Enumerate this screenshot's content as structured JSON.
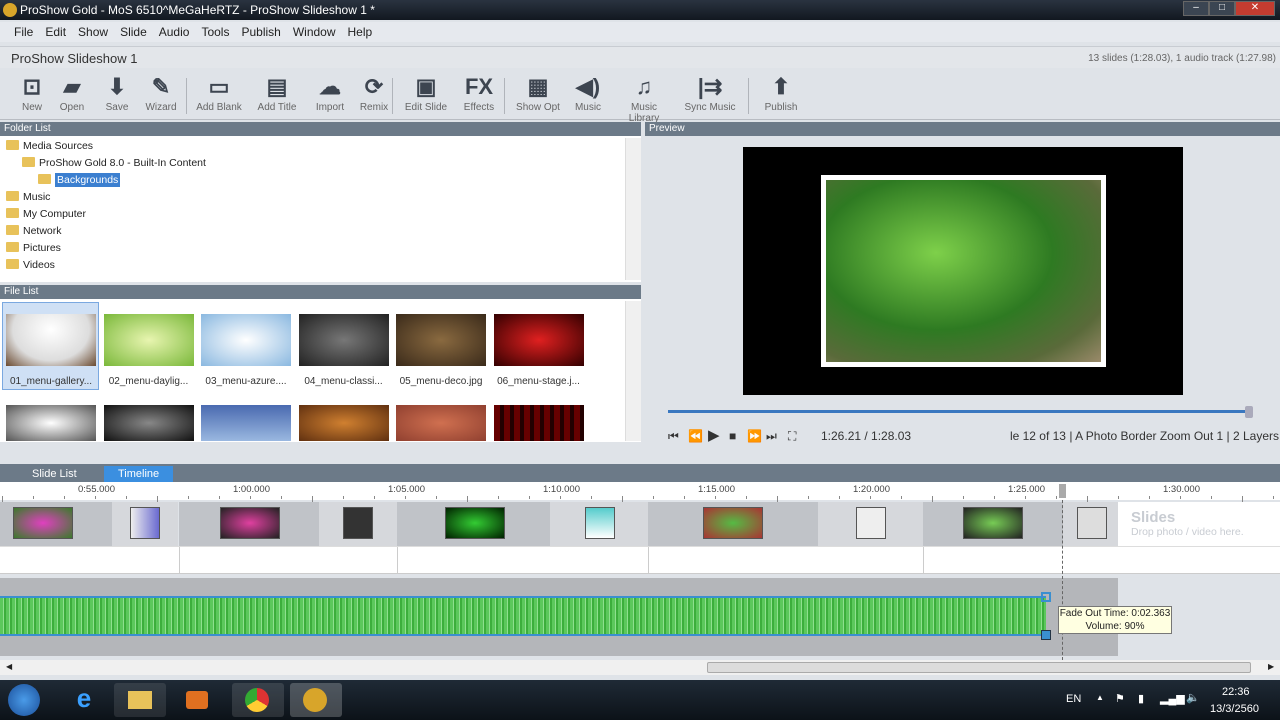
{
  "window": {
    "title": "ProShow Gold - MoS 6510^MeGaHeRTZ - ProShow Slideshow 1 *",
    "controls": [
      "minimize",
      "maximize",
      "close"
    ]
  },
  "menu": [
    "File",
    "Edit",
    "Show",
    "Slide",
    "Audio",
    "Tools",
    "Publish",
    "Window",
    "Help"
  ],
  "project": {
    "title": "ProShow Slideshow 1",
    "info": "13 slides (1:28.03), 1 audio track (1:27.98)"
  },
  "toolbar": [
    {
      "label": "New",
      "icon": "new-icon"
    },
    {
      "label": "Open",
      "icon": "open-folder-icon"
    },
    {
      "label": "Save",
      "icon": "save-icon"
    },
    {
      "label": "Wizard",
      "icon": "wizard-icon"
    },
    {
      "label": "Add Blank",
      "icon": "add-blank-icon"
    },
    {
      "label": "Add Title",
      "icon": "add-title-icon"
    },
    {
      "label": "Import",
      "icon": "cloud-import-icon"
    },
    {
      "label": "Remix",
      "icon": "remix-icon"
    },
    {
      "label": "Edit Slide",
      "icon": "edit-slide-icon"
    },
    {
      "label": "Effects",
      "icon": "fx-icon"
    },
    {
      "label": "Show Opt",
      "icon": "show-options-icon"
    },
    {
      "label": "Music",
      "icon": "speaker-icon"
    },
    {
      "label": "Music Library",
      "icon": "music-library-icon"
    },
    {
      "label": "Sync Music",
      "icon": "sync-music-icon"
    },
    {
      "label": "Publish",
      "icon": "publish-icon"
    }
  ],
  "folder_list": {
    "header": "Folder List",
    "items": [
      {
        "label": "Media Sources",
        "level": 0
      },
      {
        "label": "ProShow Gold 8.0 - Built-In Content",
        "level": 1
      },
      {
        "label": "Backgrounds",
        "level": 2,
        "selected": true
      },
      {
        "label": "Music",
        "level": 0
      },
      {
        "label": "My Computer",
        "level": 0
      },
      {
        "label": "Network",
        "level": 0
      },
      {
        "label": "Pictures",
        "level": 0
      },
      {
        "label": "Videos",
        "level": 0
      }
    ]
  },
  "file_list": {
    "header": "File List",
    "files": [
      "01_menu-gallery...",
      "02_menu-daylig...",
      "03_menu-azure....",
      "04_menu-classi...",
      "05_menu-deco.jpg",
      "06_menu-stage.j..."
    ]
  },
  "preview": {
    "header": "Preview",
    "time": "1:26.21 / 1:28.03",
    "status": "le 12 of 13  |  A Photo Border Zoom Out 1  |  2 Layers",
    "progress_percent": 98
  },
  "tabs": [
    {
      "label": "Slide List",
      "active": false
    },
    {
      "label": "Timeline",
      "active": true
    }
  ],
  "timeline": {
    "ruler": [
      "0:55.000",
      "1:00.000",
      "1:05.000",
      "1:10.000",
      "1:15.000",
      "1:20.000",
      "1:25.000",
      "1:30.000"
    ],
    "drop_title": "Slides",
    "drop_hint": "Drop photo / video here.",
    "tooltip": {
      "line1": "Fade Out Time: 0:02.363",
      "line2": "Volume: 90%"
    }
  },
  "taskbar": {
    "lang": "EN",
    "time": "22:36",
    "date": "13/3/2560"
  }
}
